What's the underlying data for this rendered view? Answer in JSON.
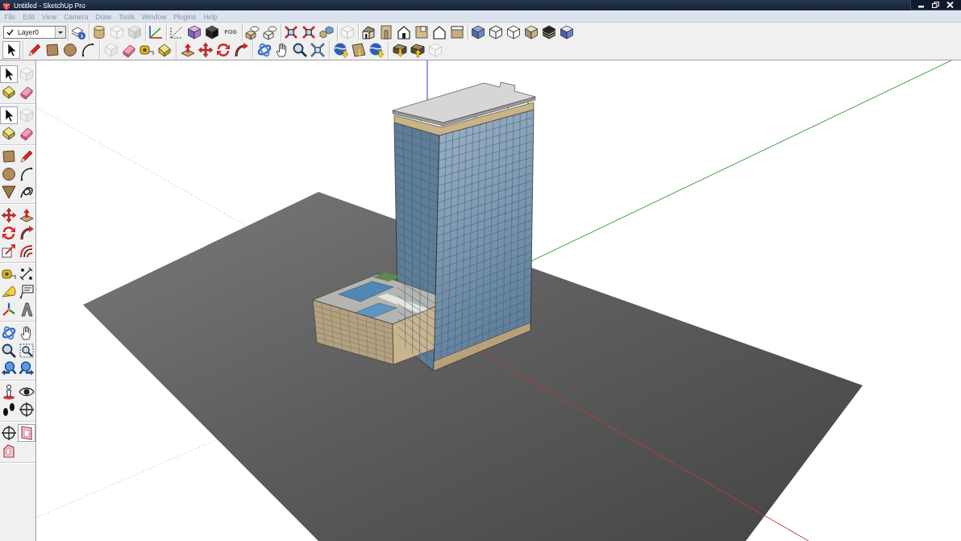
{
  "window": {
    "title": "Untitled - SketchUp Pro"
  },
  "menu_bar": [
    "File",
    "Edit",
    "View",
    "Camera",
    "Draw",
    "Tools",
    "Window",
    "Plugins",
    "Help"
  ],
  "layer_select": {
    "value": "Layer0"
  },
  "top_toolbar": [
    [
      {
        "kind": "layers",
        "disabled": false
      }
    ],
    [
      {
        "kind": "cylinder",
        "disabled": false
      },
      {
        "kind": "outline",
        "disabled": true
      },
      {
        "kind": "greybox",
        "disabled": true
      }
    ],
    [
      {
        "kind": "axes",
        "disabled": false
      }
    ],
    [
      {
        "kind": "guides",
        "disabled": false
      },
      {
        "kind": "shadows",
        "disabled": false
      },
      {
        "kind": "solid",
        "disabled": false
      },
      {
        "kind": "fog",
        "label": "FOG",
        "disabled": false
      }
    ],
    [
      {
        "kind": "shell",
        "disabled": false
      },
      {
        "kind": "intersect",
        "disabled": false
      }
    ],
    [
      {
        "kind": "extents",
        "disabled": false
      },
      {
        "kind": "extents",
        "disabled": false
      },
      {
        "kind": "components",
        "disabled": false
      }
    ],
    [
      {
        "kind": "outline",
        "disabled": true
      }
    ],
    [
      {
        "kind": "iso",
        "disabled": false
      },
      {
        "kind": "front",
        "disabled": false
      },
      {
        "kind": "top",
        "disabled": false
      },
      {
        "kind": "right",
        "disabled": false
      },
      {
        "kind": "back",
        "disabled": false
      },
      {
        "kind": "left",
        "disabled": false
      }
    ],
    [
      {
        "kind": "xray",
        "disabled": false
      },
      {
        "kind": "wireframe",
        "disabled": false
      },
      {
        "kind": "hiddenline",
        "disabled": false
      },
      {
        "kind": "shaded",
        "disabled": false
      },
      {
        "kind": "textured",
        "disabled": false
      },
      {
        "kind": "monochrome",
        "disabled": false
      }
    ]
  ],
  "tool_toolbar": [
    [
      {
        "kind": "select",
        "selected": true,
        "disabled": false
      }
    ],
    [
      {
        "kind": "pencil",
        "selected": false,
        "disabled": false
      },
      {
        "kind": "rectangle",
        "selected": false,
        "disabled": false
      },
      {
        "kind": "circle",
        "selected": false,
        "disabled": false
      },
      {
        "kind": "arc",
        "selected": false,
        "disabled": false
      }
    ],
    [
      {
        "kind": "component",
        "selected": false,
        "disabled": true
      },
      {
        "kind": "eraser",
        "selected": false,
        "disabled": false
      },
      {
        "kind": "tape",
        "selected": false,
        "disabled": false
      },
      {
        "kind": "paint",
        "selected": false,
        "disabled": false
      }
    ],
    [
      {
        "kind": "pushpull",
        "selected": false,
        "disabled": false
      },
      {
        "kind": "move",
        "selected": false,
        "disabled": false
      },
      {
        "kind": "rotate",
        "selected": false,
        "disabled": false
      },
      {
        "kind": "followme",
        "selected": false,
        "disabled": false
      }
    ],
    [
      {
        "kind": "orbit",
        "selected": false,
        "disabled": false
      },
      {
        "kind": "pan",
        "selected": false,
        "disabled": false
      },
      {
        "kind": "zoom",
        "selected": false,
        "disabled": false
      },
      {
        "kind": "zoomextents",
        "selected": false,
        "disabled": false
      }
    ],
    [
      {
        "kind": "globe",
        "selected": false,
        "disabled": false
      },
      {
        "kind": "terrain",
        "selected": false,
        "disabled": false
      },
      {
        "kind": "globe",
        "selected": false,
        "disabled": false
      }
    ],
    [
      {
        "kind": "download",
        "selected": false,
        "disabled": false
      },
      {
        "kind": "share",
        "selected": false,
        "disabled": false
      },
      {
        "kind": "outline",
        "selected": false,
        "disabled": true
      }
    ]
  ],
  "side_toolbar": [
    [
      {
        "kind": "select",
        "selected": true,
        "disabled": false
      },
      {
        "kind": "component",
        "selected": false,
        "disabled": true
      },
      {
        "kind": "paint",
        "selected": false,
        "disabled": false
      },
      {
        "kind": "eraser",
        "selected": false,
        "disabled": false
      }
    ],
    [
      {
        "kind": "select",
        "selected": true,
        "disabled": false
      },
      {
        "kind": "component",
        "selected": false,
        "disabled": true
      },
      {
        "kind": "paint",
        "selected": false,
        "disabled": false
      },
      {
        "kind": "eraser",
        "selected": false,
        "disabled": false
      }
    ],
    [
      {
        "kind": "rectangle",
        "selected": false,
        "disabled": false
      },
      {
        "kind": "pencil",
        "selected": false,
        "disabled": false
      },
      {
        "kind": "circle",
        "selected": false,
        "disabled": false
      },
      {
        "kind": "arc",
        "selected": false,
        "disabled": false
      },
      {
        "kind": "polygon",
        "selected": false,
        "disabled": false
      },
      {
        "kind": "freehand",
        "selected": false,
        "disabled": false
      }
    ],
    [
      {
        "kind": "move",
        "selected": false,
        "disabled": false
      },
      {
        "kind": "pushpull",
        "selected": false,
        "disabled": false
      },
      {
        "kind": "rotate",
        "selected": false,
        "disabled": false
      },
      {
        "kind": "followme",
        "selected": false,
        "disabled": false
      },
      {
        "kind": "scale",
        "selected": false,
        "disabled": false
      },
      {
        "kind": "offset",
        "selected": false,
        "disabled": false
      }
    ],
    [
      {
        "kind": "tape",
        "selected": false,
        "disabled": false
      },
      {
        "kind": "dimension",
        "selected": false,
        "disabled": false
      },
      {
        "kind": "protractor",
        "selected": false,
        "disabled": false
      },
      {
        "kind": "text",
        "selected": false,
        "disabled": false
      },
      {
        "kind": "axestool",
        "selected": false,
        "disabled": false
      },
      {
        "kind": "text3d",
        "selected": false,
        "disabled": false
      }
    ],
    [
      {
        "kind": "orbit",
        "selected": false,
        "disabled": false
      },
      {
        "kind": "pan",
        "selected": false,
        "disabled": false
      },
      {
        "kind": "zoom",
        "selected": false,
        "disabled": false
      },
      {
        "kind": "zoomwindow",
        "selected": false,
        "disabled": false
      },
      {
        "kind": "previous",
        "selected": false,
        "disabled": false
      },
      {
        "kind": "next",
        "selected": false,
        "disabled": false
      }
    ],
    [
      {
        "kind": "camera",
        "selected": false,
        "disabled": false
      },
      {
        "kind": "look",
        "selected": false,
        "disabled": false
      },
      {
        "kind": "walk",
        "selected": false,
        "disabled": false
      },
      {
        "kind": "crosshair",
        "selected": false,
        "disabled": false
      }
    ],
    [
      {
        "kind": "crosshair",
        "selected": false,
        "disabled": false
      },
      {
        "kind": "section",
        "selected": true,
        "disabled": false
      },
      {
        "kind": "sectioncut",
        "selected": false,
        "disabled": false
      }
    ]
  ]
}
